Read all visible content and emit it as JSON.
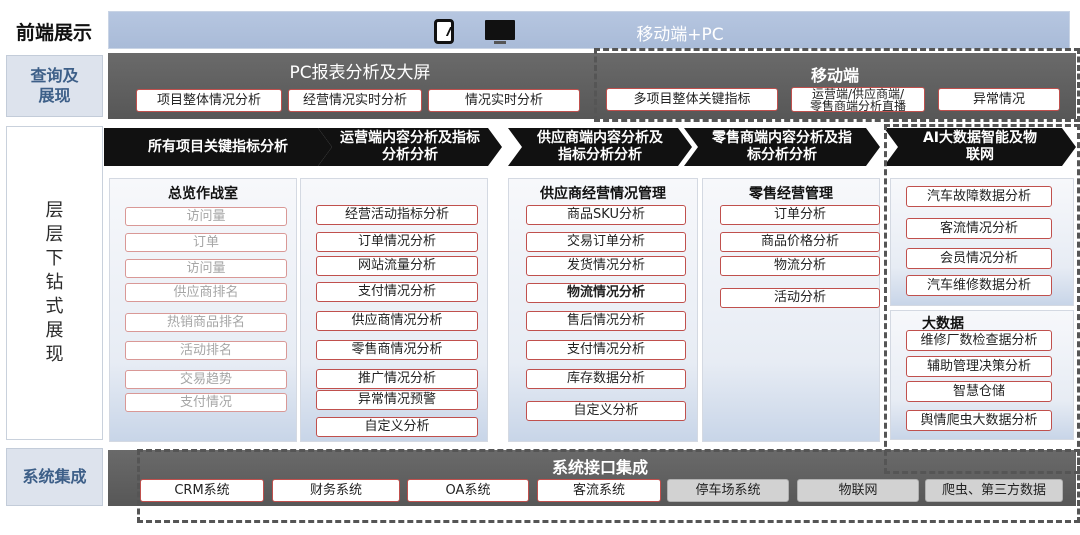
{
  "row_labels": {
    "front": "前端展示",
    "query": "查询及\n展现",
    "drill": "层\n层\n下\n钻\n式\n展\n现",
    "system": "系统集成"
  },
  "front_band": {
    "title": "移动端+PC",
    "icons": [
      "tablet-icon",
      "monitor-icon"
    ]
  },
  "pc_section": {
    "title": "PC报表分析及大屏",
    "items": [
      "项目整体情况分析",
      "经营情况实时分析",
      "情况实时分析"
    ]
  },
  "mobile_section": {
    "title": "移动端",
    "items": [
      "多项目整体关键指标",
      "运营端/供应商端/\n零售商端分析直播",
      "异常情况"
    ]
  },
  "arrows": [
    "所有项目关键指标分析",
    "运营端内容分析及指标\n分析分析",
    "供应商端内容分析及\n指标分析分析",
    "零售商端内容分析及指\n标分析分析",
    "AI大数据智能及物\n联网"
  ],
  "panels": {
    "overview": {
      "title": "总览作战室",
      "items": [
        "访问量",
        "订单",
        "访问量",
        "供应商排名",
        "热销商品排名",
        "活动排名",
        "交易趋势",
        "支付情况"
      ]
    },
    "operations": {
      "items": [
        "经营活动指标分析",
        "订单情况分析",
        "网站流量分析",
        "支付情况分析",
        "供应商情况分析",
        "零售商情况分析",
        "推广情况分析",
        "异常情况预警",
        "自定义分析"
      ]
    },
    "supplier": {
      "title": "供应商经营情况管理",
      "items": [
        "商品SKU分析",
        "交易订单分析",
        "发货情况分析",
        "物流情况分析",
        "售后情况分析",
        "支付情况分析",
        "库存数据分析",
        "自定义分析"
      ]
    },
    "retail": {
      "title": "零售经营管理",
      "items": [
        "订单分析",
        "商品价格分析",
        "物流分析",
        "活动分析"
      ]
    },
    "ai": {
      "items": [
        "汽车故障数据分析",
        "客流情况分析",
        "会员情况分析",
        "汽车维修数据分析"
      ],
      "bigdata_title": "大数据",
      "bigdata_items": [
        "维修厂数检查据分析",
        "辅助管理决策分析",
        "智慧仓储",
        "舆情爬虫大数据分析"
      ]
    }
  },
  "system_section": {
    "title": "系统接口集成",
    "items": [
      "CRM系统",
      "财务系统",
      "OA系统",
      "客流系统",
      "停车场系统",
      "物联网",
      "爬虫、第三方数据"
    ]
  },
  "colors": {
    "box_border": "#c0504d",
    "band_gray": "#616161",
    "band_blue": "#aebfdb",
    "label_blue": "#3d5f88"
  }
}
